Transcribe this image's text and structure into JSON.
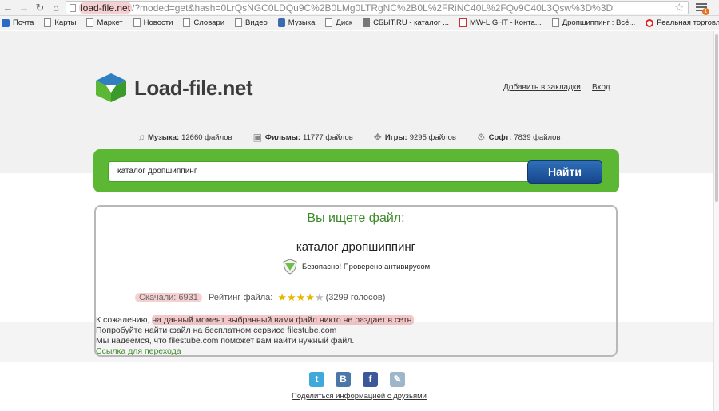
{
  "browser": {
    "url_host": "load-file.net",
    "url_path": "/?moded=get&hash=0LrQsNGC0LDQu9C%2B0LMg0LTRgNC%2B0L%2FRiNC40L%2FQv9C40L3Qsw%3D%3D",
    "menu_badge": "1",
    "bookmarks": [
      "Почта",
      "Карты",
      "Маркет",
      "Новости",
      "Словари",
      "Видео",
      "Музыка",
      "Диск",
      "СБЫТ.RU - каталог ...",
      "MW-LIGHT - Конта...",
      "Дропшиппинг : Всё...",
      "Реальная торговля ..."
    ]
  },
  "site": {
    "logo_text": "Load-file.net",
    "bookmark_link": "Добавить в закладки",
    "login_link": "Вход",
    "stats": [
      {
        "icon": "music-icon",
        "label": "Музыка:",
        "value": "12660 файлов"
      },
      {
        "icon": "film-icon",
        "label": "Фильмы:",
        "value": "11777 файлов"
      },
      {
        "icon": "gamepad-icon",
        "label": "Игры:",
        "value": "9295 файлов"
      },
      {
        "icon": "software-icon",
        "label": "Софт:",
        "value": "7839 файлов"
      }
    ],
    "search_value": "каталог дропшиппинг",
    "search_button": "Найти"
  },
  "result": {
    "title": "Вы ищете файл:",
    "query": "каталог дропшиппинг",
    "safe_text": "Безопасно! Проверено антивирусом",
    "downloads": "Скачали: 6931",
    "rating_label": "Рейтинг файла:",
    "rating_stars": 4,
    "rating_max": 5,
    "votes": "(3299 голосов)",
    "msg_prefix": "К сожалению, ",
    "msg_highlight": "на данный момент выбранный вами файл никто не раздает в сетн.",
    "msg_line2": "Попробуйте найти файл на бесплатном сервисе filestube.com",
    "msg_line3": "Мы надеемся, что filestube.com поможет вам найти нужный файл.",
    "msg_link": "Ссылка для перехода"
  },
  "footer": {
    "social": [
      {
        "name": "twitter-icon",
        "glyph": "t",
        "color": "#3fa9dc"
      },
      {
        "name": "vkontakte-icon",
        "glyph": "В",
        "color": "#4a76a8"
      },
      {
        "name": "facebook-icon",
        "glyph": "f",
        "color": "#3b5998"
      },
      {
        "name": "livejournal-icon",
        "glyph": "✎",
        "color": "#9fb6c9"
      }
    ],
    "share_text": "Поделиться информацией с друзьями"
  },
  "colors": {
    "accent_green": "#5cb834",
    "button_blue": "#1f5aa3",
    "title_green": "#3d8a2a"
  }
}
